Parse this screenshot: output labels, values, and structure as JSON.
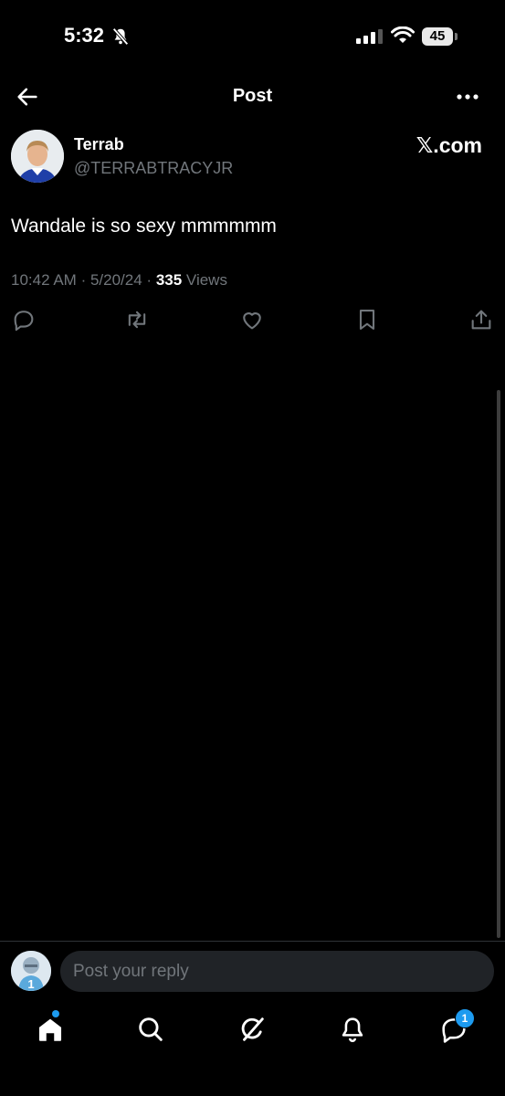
{
  "status_bar": {
    "time": "5:32",
    "battery": "45"
  },
  "nav": {
    "title": "Post"
  },
  "tweet": {
    "author_name": "Terrab",
    "author_handle": "@TERRABTRACYJR",
    "source_site": "𝕏.com",
    "text": "Wandale is so sexy mmmmmm",
    "time": "10:42 AM",
    "date": "5/20/24",
    "views_count": "335",
    "views_label": "Views"
  },
  "reply": {
    "placeholder": "Post your reply"
  },
  "tab_bar": {
    "messages_badge": "1"
  },
  "colors": {
    "background": "#000000",
    "text_primary": "#e7e9ea",
    "text_secondary": "#71767b",
    "accent": "#1d9bf0",
    "input_bg": "#202327"
  },
  "icons": [
    "bell-slash-icon",
    "signal-icon",
    "wifi-icon",
    "battery-icon",
    "back-arrow-icon",
    "more-icon",
    "reply-icon",
    "retweet-icon",
    "like-icon",
    "bookmark-icon",
    "share-icon",
    "home-icon",
    "search-icon",
    "grok-icon",
    "notifications-icon",
    "messages-icon"
  ]
}
